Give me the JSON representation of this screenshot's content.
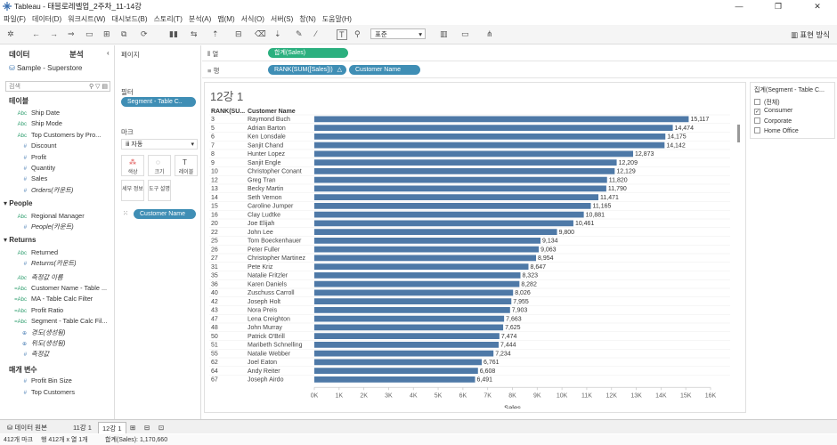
{
  "window": {
    "title": "Tableau - 태블로레벨업_2주차_11-14강",
    "controls": [
      "—",
      "❐",
      "✕"
    ]
  },
  "menu": [
    "파일(F)",
    "데이터(D)",
    "워크시트(W)",
    "대시보드(B)",
    "스토리(T)",
    "분석(A)",
    "맵(M)",
    "서식(O)",
    "서버(S)",
    "창(N)",
    "도움말(H)"
  ],
  "toolbar": {
    "fit": "표준",
    "show_me": "표현 방식"
  },
  "data_pane": {
    "tab_data": "데이터",
    "tab_analysis": "분석",
    "source": "Sample - Superstore",
    "search_placeholder": "검색",
    "tables_header": "테이블",
    "fields": [
      {
        "icon": "Abc",
        "label": "Ship Date",
        "kind": "dim"
      },
      {
        "icon": "Abc",
        "label": "Ship Mode",
        "kind": "dim"
      },
      {
        "icon": "Abc",
        "label": "Top Customers by Pro...",
        "kind": "dim"
      },
      {
        "icon": "#",
        "label": "Discount",
        "kind": "mea"
      },
      {
        "icon": "#",
        "label": "Profit",
        "kind": "mea"
      },
      {
        "icon": "#",
        "label": "Quantity",
        "kind": "mea"
      },
      {
        "icon": "#",
        "label": "Sales",
        "kind": "mea"
      },
      {
        "icon": "#",
        "label": "Orders(카운트)",
        "kind": "mea-it"
      }
    ],
    "people_header": "People",
    "people_fields": [
      {
        "icon": "Abc",
        "label": "Regional Manager",
        "kind": "dim"
      },
      {
        "icon": "#",
        "label": "People(카운트)",
        "kind": "mea-it"
      }
    ],
    "returns_header": "Returns",
    "returns_fields": [
      {
        "icon": "Abc",
        "label": "Returned",
        "kind": "dim"
      },
      {
        "icon": "#",
        "label": "Returns(카운트)",
        "kind": "mea-it"
      }
    ],
    "calc_fields": [
      {
        "icon": "Abc",
        "label": "측정값 이름",
        "kind": "dim-it"
      },
      {
        "icon": "=Abc",
        "label": "Customer Name - Table ...",
        "kind": "dim"
      },
      {
        "icon": "=Abc",
        "label": "MA - Table Calc Filter",
        "kind": "dim"
      },
      {
        "icon": "=Abc",
        "label": "Profit Ratio",
        "kind": "dim"
      },
      {
        "icon": "=Abc",
        "label": "Segment - Table Calc Fil...",
        "kind": "dim"
      },
      {
        "icon": "⊕",
        "label": "경도(생성됨)",
        "kind": "mea-it"
      },
      {
        "icon": "⊕",
        "label": "위도(생성됨)",
        "kind": "mea-it"
      },
      {
        "icon": "#",
        "label": "측정값",
        "kind": "mea-it"
      }
    ],
    "params_header": "매개 변수",
    "params": [
      {
        "icon": "#",
        "label": "Profit Bin Size"
      },
      {
        "icon": "#",
        "label": "Top Customers"
      }
    ]
  },
  "cards": {
    "pages": "페이지",
    "filters": "필터",
    "filter_pill": "Segment - Table C..",
    "marks": "마크",
    "marks_type": "자동",
    "mark_buttons": [
      "색상",
      "크기",
      "레이블",
      "세부 정보",
      "도구 설명"
    ],
    "marks_pill": "Customer Name"
  },
  "shelves": {
    "columns_label": "열",
    "columns_pill": "합계(Sales)",
    "rows_label": "행",
    "rows_pill_1": "RANK(SUM([Sales]))",
    "rows_pill_2": "Customer Name"
  },
  "sheet_title": "12강 1",
  "legend": {
    "title": "집계(Segment - Table C...",
    "items": [
      {
        "label": "(전체)",
        "checked": false
      },
      {
        "label": "Consumer",
        "checked": true
      },
      {
        "label": "Corporate",
        "checked": false
      },
      {
        "label": "Home Office",
        "checked": false
      }
    ]
  },
  "tabs": {
    "data_source": "데이터 원본",
    "sheet1": "11강 1",
    "sheet2": "12강 1"
  },
  "status": {
    "marks": "412개 마크",
    "rows": "행 412개 x 열 1개",
    "sum": "합계(Sales): 1,170,660"
  },
  "colors": {
    "bar": "#4e79a7",
    "pill_blue": "#4a90c9",
    "pill_green": "#2bb07f"
  },
  "chart_data": {
    "type": "bar",
    "orientation": "horizontal",
    "row_headers": [
      "RANK(SU...",
      "Customer Name"
    ],
    "xlabel": "Sales",
    "xlim": [
      0,
      16000
    ],
    "x_ticks": [
      "0K",
      "1K",
      "2K",
      "3K",
      "4K",
      "5K",
      "6K",
      "7K",
      "8K",
      "9K",
      "10K",
      "11K",
      "12K",
      "13K",
      "14K",
      "15K",
      "16K"
    ],
    "rows": [
      {
        "rank": "3",
        "name": "Raymond Buch",
        "value": 15117,
        "label": "15,117"
      },
      {
        "rank": "5",
        "name": "Adrian Barton",
        "value": 14474,
        "label": "14,474"
      },
      {
        "rank": "6",
        "name": "Ken Lonsdale",
        "value": 14175,
        "label": "14,175"
      },
      {
        "rank": "7",
        "name": "Sanjit Chand",
        "value": 14142,
        "label": "14,142"
      },
      {
        "rank": "8",
        "name": "Hunter Lopez",
        "value": 12873,
        "label": "12,873"
      },
      {
        "rank": "9",
        "name": "Sanjit Engle",
        "value": 12209,
        "label": "12,209"
      },
      {
        "rank": "10",
        "name": "Christopher Conant",
        "value": 12129,
        "label": "12,129"
      },
      {
        "rank": "12",
        "name": "Greg Tran",
        "value": 11820,
        "label": "11,820"
      },
      {
        "rank": "13",
        "name": "Becky Martin",
        "value": 11790,
        "label": "11,790"
      },
      {
        "rank": "14",
        "name": "Seth Vernon",
        "value": 11471,
        "label": "11,471"
      },
      {
        "rank": "15",
        "name": "Caroline Jumper",
        "value": 11165,
        "label": "11,165"
      },
      {
        "rank": "16",
        "name": "Clay Ludtke",
        "value": 10881,
        "label": "10,881"
      },
      {
        "rank": "20",
        "name": "Joe Elijah",
        "value": 10461,
        "label": "10,461"
      },
      {
        "rank": "22",
        "name": "John Lee",
        "value": 9800,
        "label": "9,800"
      },
      {
        "rank": "25",
        "name": "Tom Boeckenhauer",
        "value": 9134,
        "label": "9,134"
      },
      {
        "rank": "26",
        "name": "Peter Fuller",
        "value": 9063,
        "label": "9,063"
      },
      {
        "rank": "27",
        "name": "Christopher Martinez",
        "value": 8954,
        "label": "8,954"
      },
      {
        "rank": "31",
        "name": "Pete Kriz",
        "value": 8647,
        "label": "8,647"
      },
      {
        "rank": "35",
        "name": "Natalie Fritzler",
        "value": 8323,
        "label": "8,323"
      },
      {
        "rank": "36",
        "name": "Karen Daniels",
        "value": 8282,
        "label": "8,282"
      },
      {
        "rank": "40",
        "name": "Zuschuss Carroll",
        "value": 8026,
        "label": "8,026"
      },
      {
        "rank": "42",
        "name": "Joseph Holt",
        "value": 7955,
        "label": "7,955"
      },
      {
        "rank": "43",
        "name": "Nora Preis",
        "value": 7903,
        "label": "7,903"
      },
      {
        "rank": "47",
        "name": "Lena Creighton",
        "value": 7663,
        "label": "7,663"
      },
      {
        "rank": "48",
        "name": "John Murray",
        "value": 7625,
        "label": "7,625"
      },
      {
        "rank": "50",
        "name": "Patrick O'Brill",
        "value": 7474,
        "label": "7,474"
      },
      {
        "rank": "51",
        "name": "Maribeth Schnelling",
        "value": 7444,
        "label": "7,444"
      },
      {
        "rank": "55",
        "name": "Natalie Webber",
        "value": 7234,
        "label": "7,234"
      },
      {
        "rank": "62",
        "name": "Joel Eaton",
        "value": 6761,
        "label": "6,761"
      },
      {
        "rank": "64",
        "name": "Andy Reiter",
        "value": 6608,
        "label": "6,608"
      },
      {
        "rank": "67",
        "name": "Joseph Airdo",
        "value": 6491,
        "label": "6,491"
      }
    ]
  }
}
